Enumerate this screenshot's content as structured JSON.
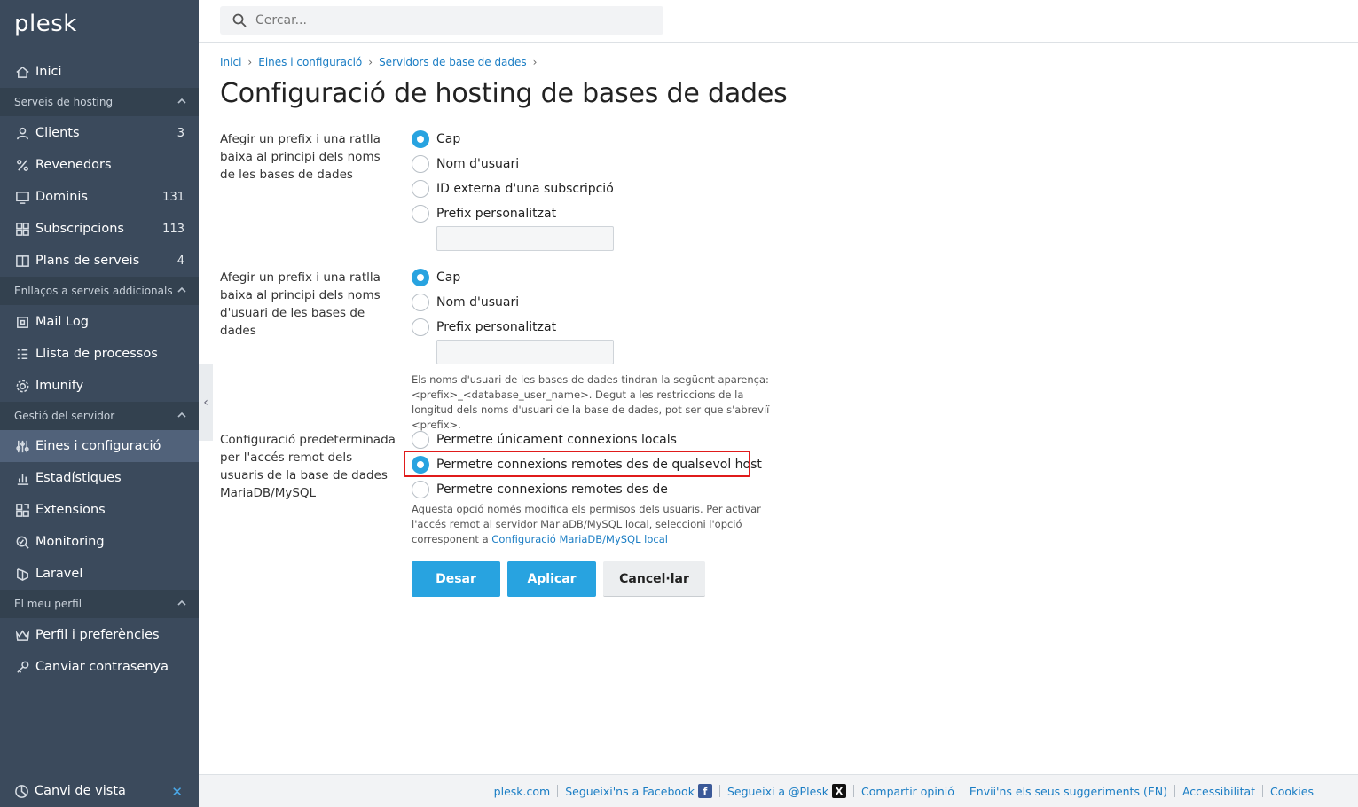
{
  "brand": {
    "logo": "plesk"
  },
  "search": {
    "placeholder": "Cercar..."
  },
  "sidebar": {
    "home": {
      "label": "Inici",
      "icon": "home-icon"
    },
    "sections": [
      {
        "label": "Serveis de hosting"
      },
      {
        "label": "Enllaços a serveis addicionals"
      },
      {
        "label": "Gestió del servidor"
      },
      {
        "label": "El meu perfil"
      }
    ],
    "hosting": [
      {
        "label": "Clients",
        "count": "3",
        "icon": "user-icon"
      },
      {
        "label": "Revenedors",
        "count": "",
        "icon": "percent-icon"
      },
      {
        "label": "Dominis",
        "count": "131",
        "icon": "monitor-icon"
      },
      {
        "label": "Subscripcions",
        "count": "113",
        "icon": "grid-icon"
      },
      {
        "label": "Plans de serveis",
        "count": "4",
        "icon": "book-icon"
      }
    ],
    "links": [
      {
        "label": "Mail Log",
        "icon": "square-icon"
      },
      {
        "label": "Llista de processos",
        "icon": "list-icon"
      },
      {
        "label": "Imunify",
        "icon": "gear-icon"
      }
    ],
    "server": [
      {
        "label": "Eines i configuració",
        "icon": "sliders-icon"
      },
      {
        "label": "Estadístiques",
        "icon": "bar-chart-icon"
      },
      {
        "label": "Extensions",
        "icon": "extensions-icon"
      },
      {
        "label": "Monitoring",
        "icon": "monitoring-icon"
      },
      {
        "label": "Laravel",
        "icon": "laravel-icon"
      }
    ],
    "profile": [
      {
        "label": "Perfil i preferències",
        "icon": "crown-icon"
      },
      {
        "label": "Canviar contrasenya",
        "icon": "key-icon"
      }
    ],
    "view_switch": {
      "label": "Canvi de vista",
      "close": "✕"
    }
  },
  "breadcrumb": [
    "Inici",
    "Eines i configuració",
    "Servidors de base de dades"
  ],
  "page": {
    "title": "Configuració de hosting de bases de dades"
  },
  "form": {
    "db_prefix": {
      "label": "Afegir un prefix i una ratlla baixa al principi dels noms de les bases de dades",
      "options": [
        "Cap",
        "Nom d'usuari",
        "ID externa d'una subscripció",
        "Prefix personalitzat"
      ],
      "selected": "Cap",
      "custom_value": ""
    },
    "user_prefix": {
      "label": "Afegir un prefix i una ratlla baixa al principi dels noms d'usuari de les bases de dades",
      "options": [
        "Cap",
        "Nom d'usuari",
        "Prefix personalitzat"
      ],
      "selected": "Cap",
      "custom_value": "",
      "hint": "Els noms d'usuari de les bases de dades tindran la següent aparença: <prefix>_<database_user_name>. Degut a les restriccions de la longitud dels noms d'usuari de la base de dades, pot ser que s'abreviï <prefix>."
    },
    "remote_access": {
      "label": "Configuració predeterminada per l'accés remot dels usuaris de la base de dades MariaDB/MySQL",
      "options": [
        "Permetre únicament connexions locals",
        "Permetre connexions remotes des de qualsevol host",
        "Permetre connexions remotes des de"
      ],
      "selected": "Permetre connexions remotes des de qualsevol host",
      "hint_text": "Aquesta opció només modifica els permisos dels usuaris. Per activar l'accés remot al servidor MariaDB/MySQL local, seleccioni l'opció corresponent a ",
      "hint_link": "Configuració MariaDB/MySQL local"
    },
    "buttons": {
      "save": "Desar",
      "apply": "Aplicar",
      "cancel": "Cancel·lar"
    }
  },
  "footer": {
    "links": [
      "plesk.com",
      "Segueixi'ns a Facebook",
      "Segueixi a @Plesk",
      "Compartir opinió",
      "Envii'ns els seus suggeriments (EN)",
      "Accessibilitat",
      "Cookies"
    ],
    "fb_glyph": "f",
    "x_glyph": "X"
  },
  "colors": {
    "accent": "#28a3e0",
    "sidebar": "#3b4a5c",
    "highlight": "#e01b1b"
  }
}
